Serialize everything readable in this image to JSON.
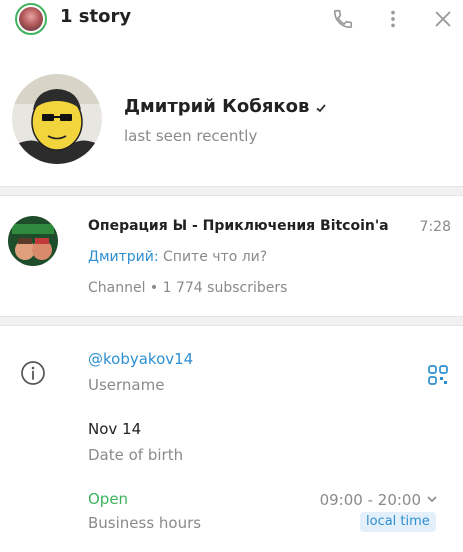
{
  "header": {
    "title": "1 story",
    "icons": [
      "phone-icon",
      "more-vertical-icon",
      "close-icon"
    ]
  },
  "profile": {
    "name": "Дмитрий Кобяков",
    "status": "last seen recently"
  },
  "channel": {
    "title": "Операция Ы - Приключения Bitcoin'a",
    "time": "7:28",
    "author": "Дмитрий",
    "author_sep": ": ",
    "message": "Спите что ли?",
    "meta": "Channel • 1 774 subscribers"
  },
  "info": {
    "username": "@kobyakov14",
    "username_label": "Username",
    "birthday": "Nov 14",
    "birthday_label": "Date of birth",
    "business_status": "Open",
    "business_label": "Business hours",
    "hours": "09:00 - 20:00",
    "timezone_badge": "local time"
  },
  "colors": {
    "accent": "#2d8fd1",
    "open": "#3fb35e",
    "secondary_text": "#8a8a8a"
  }
}
